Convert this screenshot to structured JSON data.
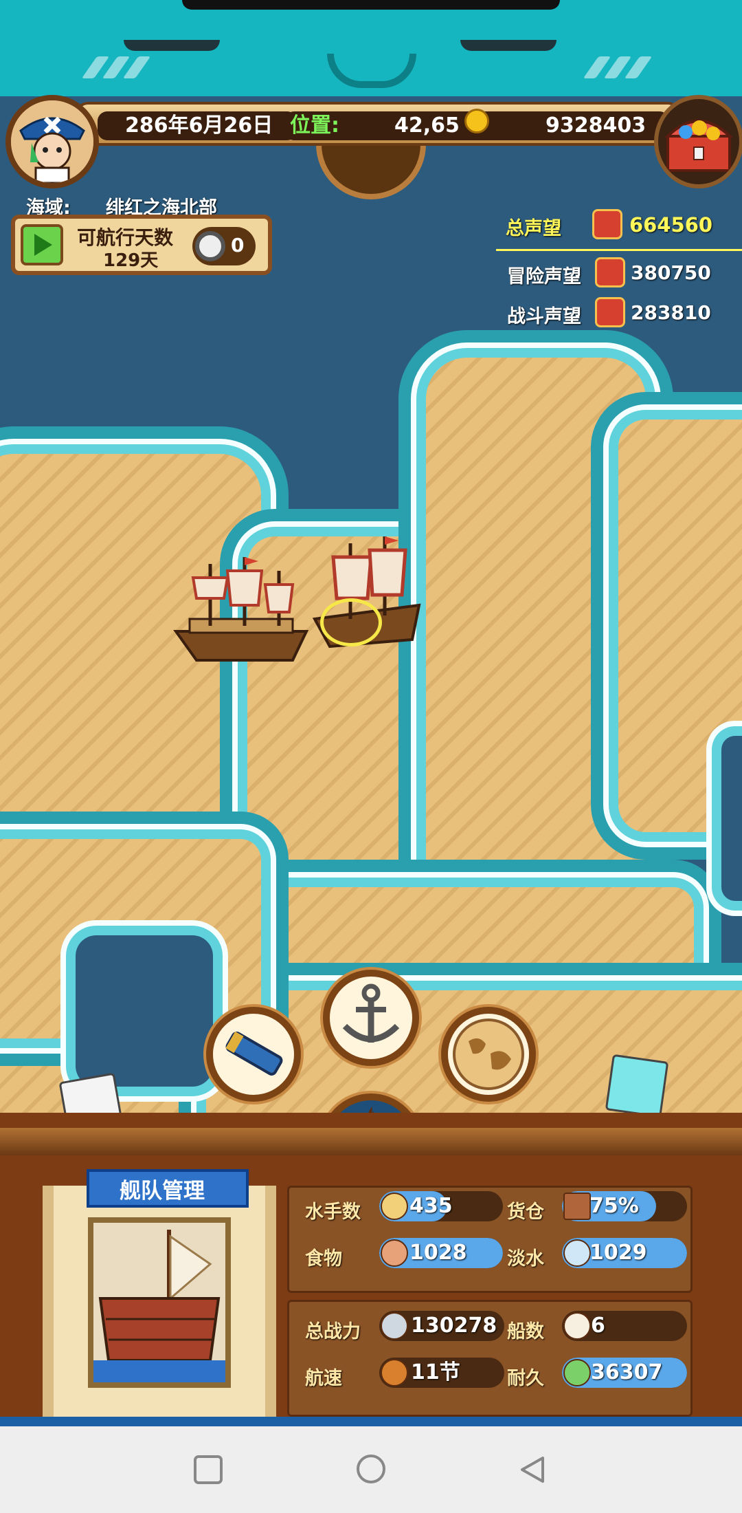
{
  "hud": {
    "date": "286年6月26日",
    "position_label": "位置:",
    "position_value": "42,65",
    "gold": "9328403"
  },
  "sea_area": {
    "label": "海域:",
    "name": "绯红之海北部"
  },
  "sailing": {
    "label": "可航行天数",
    "days": "129天",
    "counter": "0"
  },
  "reputation": {
    "total_label": "总声望",
    "total_value": "664560",
    "adventure_label": "冒险声望",
    "adventure_value": "380750",
    "battle_label": "战斗声望",
    "battle_value": "283810"
  },
  "actions": {
    "telescope": "telescope-icon",
    "anchor": "anchor-icon",
    "world_map": "world-map-icon",
    "sail": "sailboat-icon"
  },
  "fleet": {
    "title": "舰队管理",
    "sailors_label": "水手数",
    "sailors_value": "435",
    "sailors_fill": 0.55,
    "cargo_label": "货仓",
    "cargo_value": "75%",
    "cargo_fill": 0.75,
    "food_label": "食物",
    "food_value": "1028",
    "food_fill": 1.0,
    "water_label": "淡水",
    "water_value": "1029",
    "water_fill": 1.0,
    "power_label": "总战力",
    "power_value": "130278",
    "ships_label": "船数",
    "ships_value": "6",
    "speed_label": "航速",
    "speed_value": "11节",
    "durability_label": "耐久",
    "durability_value": "36307",
    "durability_fill": 1.0
  },
  "colors": {
    "sea": "#2d5b7d",
    "sand": "#e8c07c",
    "accent_green": "#7cf45a",
    "rep_yellow": "#fff65a",
    "bar_blue": "#5aa7ea"
  }
}
